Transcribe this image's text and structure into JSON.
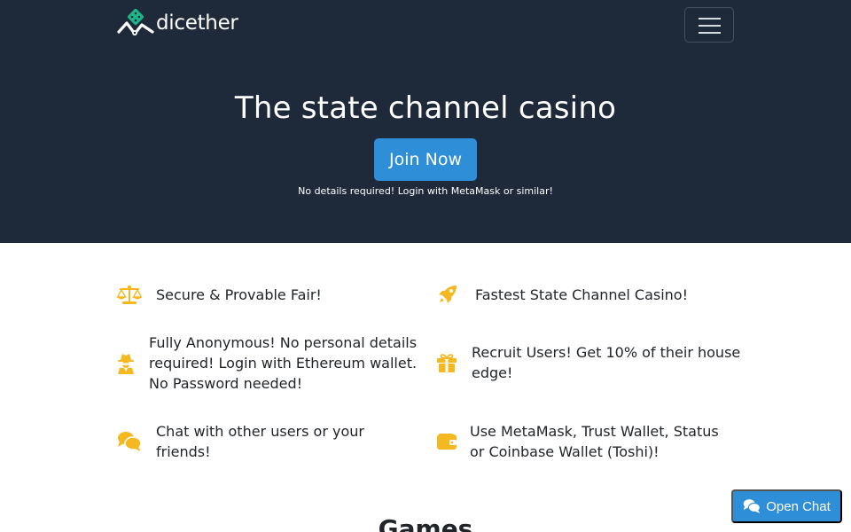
{
  "brand": {
    "name": "dicether",
    "logo_icon": "dice-mountain-logo-icon"
  },
  "navbar": {
    "menu_icon": "hamburger-menu-icon"
  },
  "hero": {
    "title": "The state channel casino",
    "cta_label": "Join Now",
    "note": "No details required! Login with MetaMask or similar!"
  },
  "features": [
    {
      "icon": "balance-scale-icon",
      "text": "Secure & Provable Fair!"
    },
    {
      "icon": "rocket-icon",
      "text": "Fastest State Channel Casino!"
    },
    {
      "icon": "user-secret-icon",
      "text": "Fully Anonymous! No personal details required! Login with Ethereum wallet. No Password needed!"
    },
    {
      "icon": "gift-icon",
      "text": "Recruit Users! Get 10% of their house edge!"
    },
    {
      "icon": "comments-icon",
      "text": "Chat with other users or your friends!"
    },
    {
      "icon": "wallet-icon",
      "text": "Use MetaMask, Trust Wallet, Status or Coinbase Wallet (Toshi)!"
    }
  ],
  "games": {
    "heading": "Games"
  },
  "chat": {
    "label": "Open Chat",
    "icon": "comments-icon"
  },
  "colors": {
    "hero_bg": "#1e2a3a",
    "accent": "#2e8ed8",
    "feature_icon": "#f5b820",
    "logo_accent": "#1fb589"
  }
}
